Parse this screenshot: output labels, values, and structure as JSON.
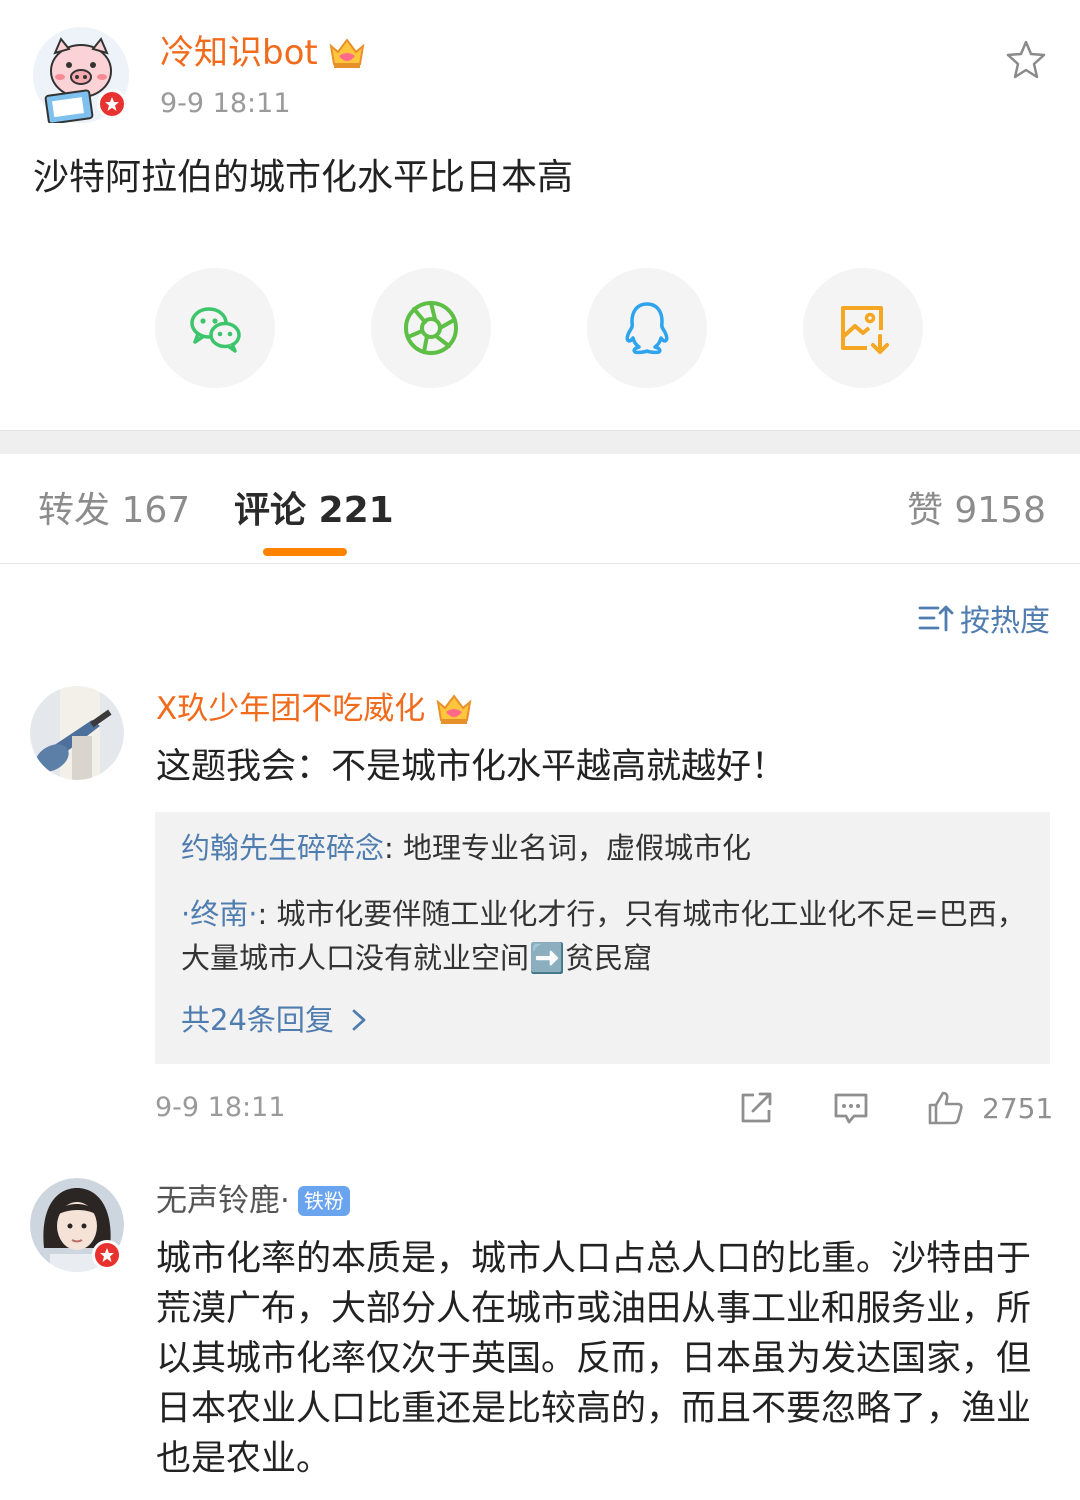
{
  "post": {
    "author": "冷知识bot",
    "time": "9-9 18:11",
    "content": "沙特阿拉伯的城市化水平比日本高",
    "avatar_icon": "pig-avatar",
    "badge_icon": "verified-badge-icon"
  },
  "share": {
    "items": [
      {
        "icon": "wechat-icon",
        "color": "#3cc56a"
      },
      {
        "icon": "moments-icon",
        "color": "#5dbf45"
      },
      {
        "icon": "qq-icon",
        "color": "#2ea4ef"
      },
      {
        "icon": "save-image-icon",
        "color": "#f5a623"
      }
    ]
  },
  "tabs": {
    "repost": "转发 167",
    "comments": "评论 221",
    "likes": "赞 9158",
    "accent": "#ff8200"
  },
  "sort": {
    "label": "按热度"
  },
  "comments": [
    {
      "user": "X玖少年团不吃威化",
      "text": "这题我会：不是城市化水平越高就越好！",
      "replies": [
        {
          "user": "约翰先生碎碎念",
          "text": ": 地理专业名词，虚假城市化"
        },
        {
          "user": "·终南·",
          "text": ": 城市化要伴随工业化才行，只有城市化工业化不足=巴西，大量城市人口没有就业空间",
          "emoji": "➡️",
          "after": "贫民窟"
        }
      ],
      "more_replies": "共24条回复",
      "time": "9-9 18:11",
      "like_count": "2751"
    },
    {
      "user": "无声铃鹿·",
      "fan_badge": "铁粉",
      "text": "城市化率的本质是，城市人口占总人口的比重。沙特由于荒漠广布，大部分人在城市或油田从事工业和服务业，所以其城市化率仅次于英国。反而，日本虽为发达国家，但日本农业人口比重还是比较高的，而且不要忽略了，渔业也是农业。"
    }
  ]
}
